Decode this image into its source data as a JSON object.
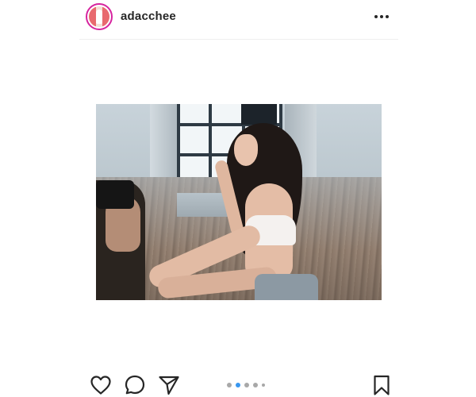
{
  "post": {
    "username": "adacchee",
    "header_icons": {
      "avatar": "profile-avatar",
      "more": "more-options-icon"
    }
  },
  "actions": {
    "icons": [
      "heart-icon",
      "comment-icon",
      "share-icon",
      "bookmark-icon"
    ]
  },
  "carousel": {
    "total": 5,
    "active_index": 1,
    "active_color": "#3897f0",
    "inactive_color": "#a8a8a8"
  }
}
